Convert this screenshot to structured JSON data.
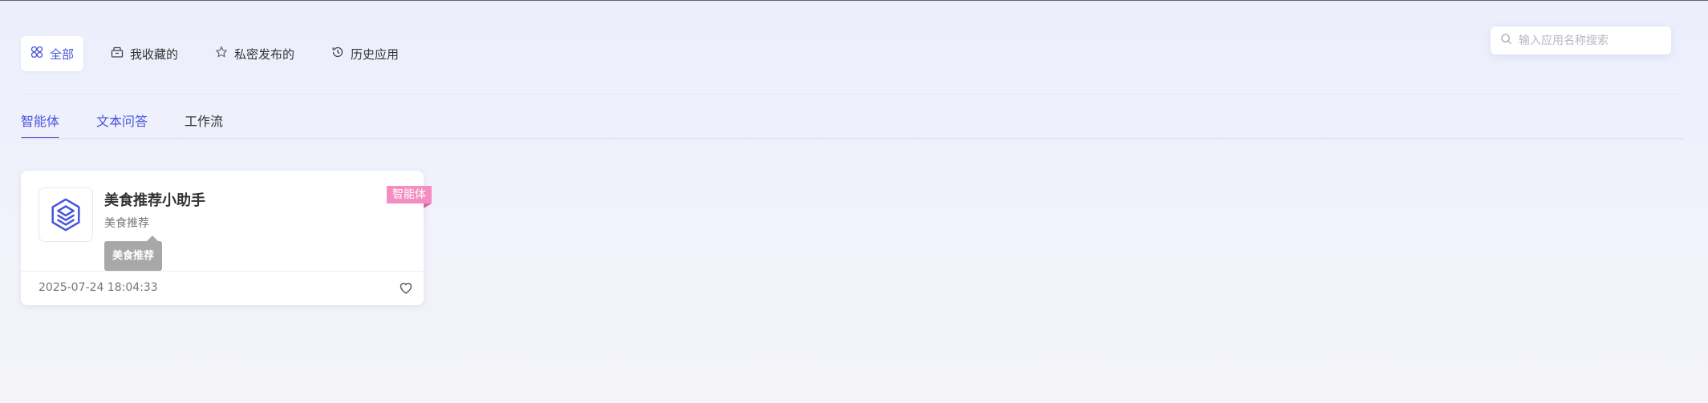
{
  "top_nav": {
    "items": [
      {
        "label": "全部",
        "icon": "grid-icon",
        "active": true
      },
      {
        "label": "我收藏的",
        "icon": "box-icon",
        "active": false
      },
      {
        "label": "私密发布的",
        "icon": "star-icon",
        "active": false
      },
      {
        "label": "历史应用",
        "icon": "history-icon",
        "active": false
      }
    ]
  },
  "search": {
    "placeholder": "输入应用名称搜索",
    "value": ""
  },
  "tabs": [
    {
      "label": "智能体",
      "active": true
    },
    {
      "label": "文本问答",
      "active": false
    },
    {
      "label": "工作流",
      "active": false
    }
  ],
  "cards": [
    {
      "title": "美食推荐小助手",
      "description": "美食推荐",
      "tag": "智能体",
      "tooltip": "美食推荐",
      "date": "2025-07-24 18:04:33",
      "icon": "layers-app-icon"
    }
  ],
  "colors": {
    "accent": "#4754dd",
    "tag": "#f48ec0",
    "tooltip_bg": "#a8a8a8"
  }
}
